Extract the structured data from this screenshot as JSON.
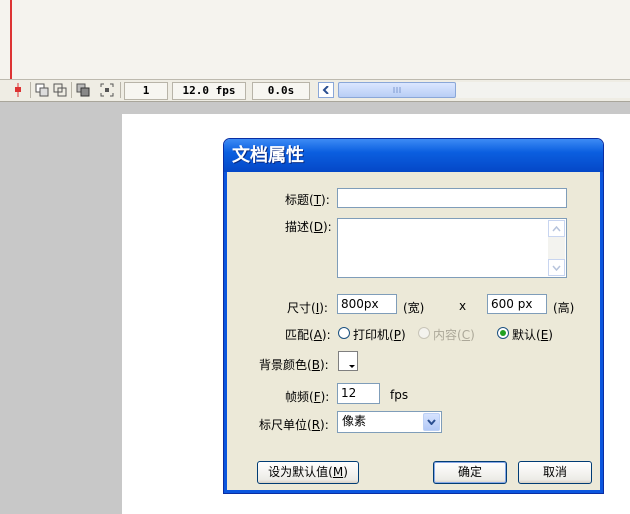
{
  "status_bar": {
    "frame": "1",
    "fps": "12.0 fps",
    "time": "0.0s"
  },
  "dialog": {
    "title": "文档属性",
    "fields": {
      "title_label": "标题",
      "title_key": "T",
      "title_value": "",
      "description_label": "描述",
      "description_key": "D",
      "description_value": "",
      "dimensions_label": "尺寸",
      "dimensions_key": "I",
      "width_value": "800px",
      "width_unit": "(宽)",
      "times": "x",
      "height_value": "600 px",
      "height_unit": "(高)",
      "match_label": "匹配",
      "match_key": "A",
      "background_label": "背景颜色",
      "background_key": "B",
      "background_color": "#ffffff",
      "framerate_label": "帧频",
      "framerate_key": "F",
      "framerate_value": "12",
      "framerate_unit": "fps",
      "ruler_label": "标尺单位",
      "ruler_key": "R",
      "ruler_value": "像素"
    },
    "match_options": [
      {
        "label": "打印机",
        "key": "P",
        "selected": false,
        "disabled": false
      },
      {
        "label": "内容",
        "key": "C",
        "selected": false,
        "disabled": true
      },
      {
        "label": "默认",
        "key": "E",
        "selected": true,
        "disabled": false
      }
    ],
    "buttons": {
      "make_default": "设为默认值",
      "make_default_key": "M",
      "ok": "确定",
      "cancel": "取消"
    }
  },
  "colors": {
    "title_bar": "#0b5fe0",
    "dialog_bg": "#ece9d8",
    "stage_bg": "#ffffff",
    "pasteboard": "#c8c8c8",
    "playhead": "#dd3333"
  }
}
